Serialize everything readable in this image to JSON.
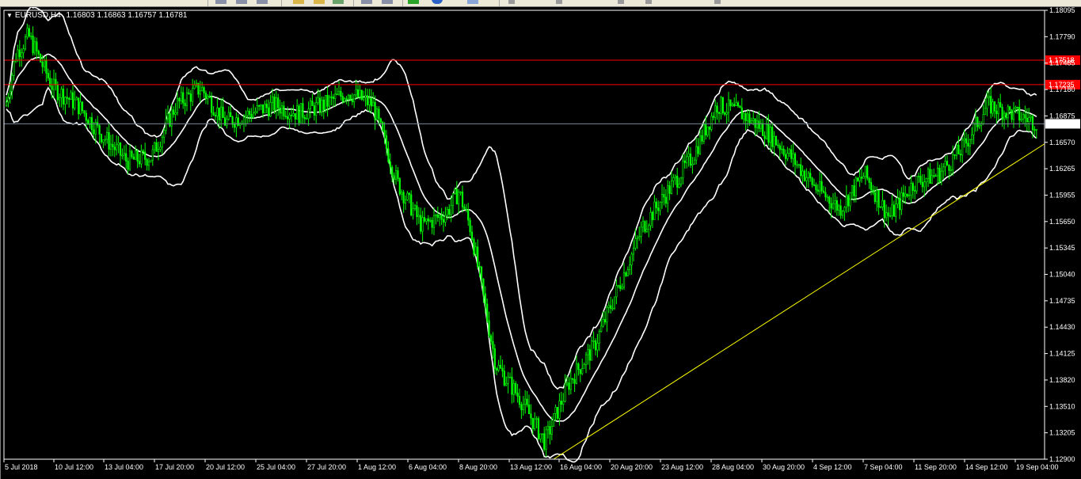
{
  "window": {
    "symbol": "EURUSD,H4",
    "open": "1.16803",
    "high": "1.16863",
    "low": "1.16757",
    "close": "1.16781"
  },
  "colors": {
    "background": "#000000",
    "frame": "#ffffff",
    "candle": "#00ff00",
    "bollinger": "#ffffff",
    "resistance": "#ff0000",
    "bid_line": "#778899",
    "trendline": "#ffff00"
  },
  "chart_data": {
    "type": "candlestick",
    "symbol": "EURUSD",
    "timeframe": "H4",
    "ylim": [
      1.129,
      1.181
    ],
    "price_axis_labels": [
      "1.18095",
      "1.17790",
      "1.17485",
      "1.17180",
      "1.16875",
      "1.16570",
      "1.16265",
      "1.15955",
      "1.15650",
      "1.15345",
      "1.15040",
      "1.14735",
      "1.14430",
      "1.14125",
      "1.13820",
      "1.13510",
      "1.13205",
      "1.12900"
    ],
    "time_axis_labels": [
      "5 Jul 2018",
      "10 Jul 12:00",
      "13 Jul 04:00",
      "17 Jul 20:00",
      "20 Jul 12:00",
      "25 Jul 04:00",
      "27 Jul 20:00",
      "1 Aug 12:00",
      "6 Aug 04:00",
      "8 Aug 20:00",
      "13 Aug 12:00",
      "16 Aug 04:00",
      "20 Aug 20:00",
      "23 Aug 12:00",
      "28 Aug 04:00",
      "30 Aug 20:00",
      "4 Sep 12:00",
      "7 Sep 04:00",
      "11 Sep 20:00",
      "14 Sep 12:00",
      "19 Sep 04:00"
    ],
    "horizontal_lines": [
      {
        "label": "1.17518",
        "price": 1.17518,
        "color": "#ff0000"
      },
      {
        "label": "1.17235",
        "price": 1.17235,
        "color": "#ff0000"
      },
      {
        "label": "1.16781",
        "price": 1.16781,
        "color": "#778899"
      }
    ],
    "trendline": {
      "from": {
        "t": "14 Aug 20:00",
        "price": 1.129
      },
      "to": {
        "t": "20 Sep 08:00",
        "price": 1.166
      }
    },
    "close_path": {
      "x": [
        0.0,
        0.5,
        1.0,
        1.5,
        2.0,
        3.0,
        4.0,
        5.0,
        6.0,
        7.0,
        8.0,
        9.0,
        10.0,
        11.0,
        12.0,
        13.0,
        14.0,
        15.0,
        16.0,
        17.0,
        18.0,
        18.5,
        19.0,
        20.0
      ],
      "price": [
        1.169,
        1.176,
        1.178,
        1.175,
        1.172,
        1.17,
        1.1665,
        1.1635,
        1.164,
        1.17,
        1.172,
        1.168,
        1.169,
        1.17,
        1.169,
        1.17,
        1.1715,
        1.17,
        1.161,
        1.156,
        1.1575,
        1.16,
        1.1555,
        1.14
      ]
    },
    "close_path_2": {
      "x": [
        20.0,
        21.0,
        22.0,
        23.0,
        24.0,
        25.0,
        26.0,
        27.0,
        28.0,
        29.0,
        30.0,
        31.0,
        32.0,
        33.0,
        34.0,
        35.0,
        36.0,
        37.0,
        38.0,
        39.0,
        40.0,
        41.0,
        42.0
      ],
      "price": [
        1.14,
        1.136,
        1.131,
        1.138,
        1.142,
        1.149,
        1.156,
        1.16,
        1.164,
        1.17,
        1.169,
        1.167,
        1.164,
        1.1605,
        1.158,
        1.162,
        1.157,
        1.161,
        1.162,
        1.165,
        1.17,
        1.169,
        1.168
      ]
    }
  }
}
